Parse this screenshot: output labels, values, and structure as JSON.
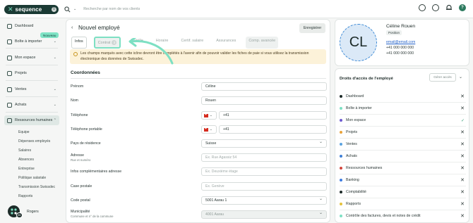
{
  "topbar": {
    "logo_text": "sequence",
    "logo_badge": "0",
    "search_placeholder": "Recherche par nom de vos clients",
    "help": "?"
  },
  "sidebar": {
    "items": [
      {
        "label": "Dashboard"
      },
      {
        "label": "Boîte à importer"
      },
      {
        "label": "Mon espace"
      },
      {
        "label": "Projets"
      },
      {
        "label": "Ventes"
      },
      {
        "label": "Achats"
      },
      {
        "label": "Ressources humaines"
      }
    ],
    "new_badge": "Nouveau",
    "sub_items": [
      "Equipe",
      "Dépenses employés",
      "Salaires",
      "Absences",
      "Entreprise",
      "Politique salariale",
      "Transmission Swissdec",
      "Rapports"
    ],
    "user_name": "Rogers",
    "user_count": "26"
  },
  "main": {
    "title": "Nouvel employé",
    "save_label": "Enregistrer",
    "tabs": [
      {
        "label": "Infos"
      },
      {
        "label": "Contrat",
        "count": "3"
      },
      {
        "label": "Famille"
      },
      {
        "label": "Horaire"
      },
      {
        "label": "Certif. salaire"
      },
      {
        "label": "Assurances"
      },
      {
        "label": "Comp. avancée"
      }
    ],
    "notice": "Les champs marqués avec cette icône devront être complétés à l'avenir afin de pouvoir valider les fiches de paie si vous utilisez la transmission électronique des données de Swissdec.",
    "section_title": "Coordonnées",
    "fields": [
      {
        "label": "Prénom",
        "value": "Céline"
      },
      {
        "label": "Nom",
        "value": "Rouen"
      },
      {
        "label": "Téléphone",
        "value": "+41"
      },
      {
        "label": "Téléphone portable",
        "value": "+41"
      },
      {
        "label": "Pays de résidence",
        "value": "Suisse"
      },
      {
        "label": "Adresse",
        "sub": "Rue et numéro",
        "placeholder": "Ex. Rue Agassiz 54"
      },
      {
        "label": "Infos complémentaires adresse",
        "placeholder": "Ex. Deuxième étage"
      },
      {
        "label": "Case postale",
        "placeholder": "Ex. Genève"
      },
      {
        "label": "Code postal",
        "value": "5001 Aarau 1"
      },
      {
        "label": "Municipalité",
        "sub": "Commune et n° de la commune",
        "value": "4001 Aarau"
      }
    ]
  },
  "profile": {
    "initials": "CL",
    "name": "Céline Rouen",
    "position": "Position",
    "email": "email@email.com",
    "phones": [
      "+41 000 000 000",
      "+41 000 000 000"
    ]
  },
  "access": {
    "title": "Droits d'accès de l'employé",
    "manage_label": "Gérer accès",
    "rows": [
      {
        "label": "Dashboard",
        "color": "#1c2a27",
        "granted": false
      },
      {
        "label": "Boîte à importer",
        "color": "#7de0c3",
        "granted": false
      },
      {
        "label": "Mon espace",
        "color": "#6d5bd0",
        "granted": true
      },
      {
        "label": "Projets",
        "color": "#e8a33b",
        "granted": false
      },
      {
        "label": "Ventes",
        "color": "#5ba3e0",
        "granted": false
      },
      {
        "label": "Achats",
        "color": "#3f7fd6",
        "granted": false
      },
      {
        "label": "Ressources humaines",
        "color": "#d2463d",
        "granted": false
      },
      {
        "label": "Banking",
        "color": "#3c7be0",
        "granted": false
      },
      {
        "label": "Comptabilité",
        "color": "#1c2a27",
        "granted": false
      },
      {
        "label": "Rapports",
        "color": "#e5c23a",
        "granted": false
      },
      {
        "label": "Contrôle des factures, devis et notes de crédit",
        "color": "#7de0c3",
        "granted": false
      }
    ]
  }
}
